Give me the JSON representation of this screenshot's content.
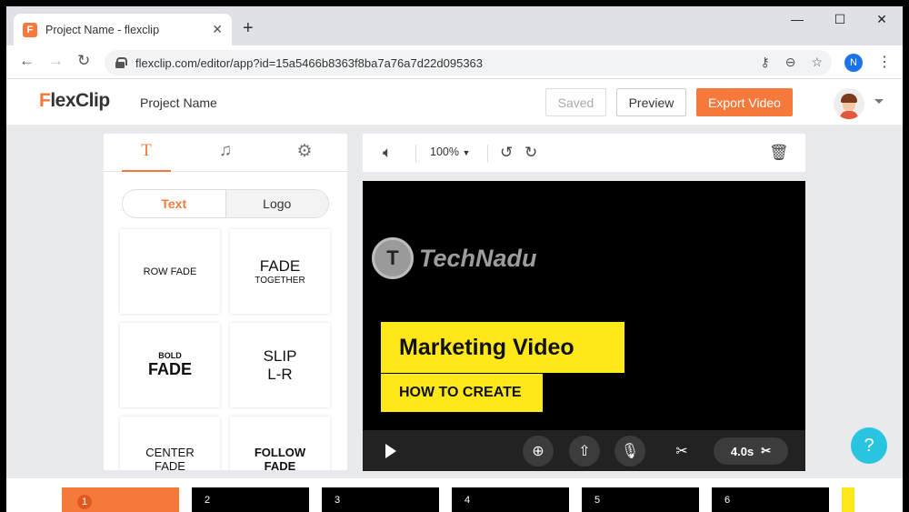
{
  "browser": {
    "tab_title": "Project Name - flexclip",
    "favicon_letter": "F",
    "close_tab": "✕",
    "new_tab": "+",
    "minimize": "—",
    "maximize": "☐",
    "close_window": "✕",
    "url": "flexclip.com/editor/app?id=15a5466b8363f8ba7a76a7d22d095363",
    "profile_initial": "N"
  },
  "header": {
    "logo_f": "F",
    "logo_rest": "lexClip",
    "project_name": "Project Name",
    "saved_label": "Saved",
    "preview_label": "Preview",
    "export_label": "Export Video"
  },
  "panel": {
    "tabs": [
      {
        "icon": "text-icon",
        "glyph": "T"
      },
      {
        "icon": "music-icon",
        "glyph": "♫"
      },
      {
        "icon": "settings-icon",
        "glyph": "⚙"
      }
    ],
    "segments": {
      "text": "Text",
      "logo": "Logo"
    },
    "cards": [
      {
        "line1": "ROW FADE",
        "line2": ""
      },
      {
        "line1": "FADE",
        "line2": "TOGETHER"
      },
      {
        "line1": "BOLD",
        "line2": "FADE"
      },
      {
        "line1": "SLIP",
        "line2": "L-R"
      },
      {
        "line1": "CENTER",
        "line2": "FADE"
      },
      {
        "line1": "FOLLOW",
        "line2": "FADE"
      }
    ]
  },
  "toolbar": {
    "zoom": "100%",
    "zoom_caret": "▼"
  },
  "stage": {
    "watermark": "TechNadu",
    "watermark_mark": "T",
    "title": "Marketing Video",
    "subtitle": "HOW TO CREATE",
    "duration": "4.0s"
  },
  "help": "?",
  "timeline": {
    "scenes": [
      "1",
      "2",
      "3",
      "4",
      "5",
      "6"
    ]
  },
  "colors": {
    "accent": "#f4793b",
    "highlight": "#ffe81a",
    "help": "#29c4e0"
  }
}
